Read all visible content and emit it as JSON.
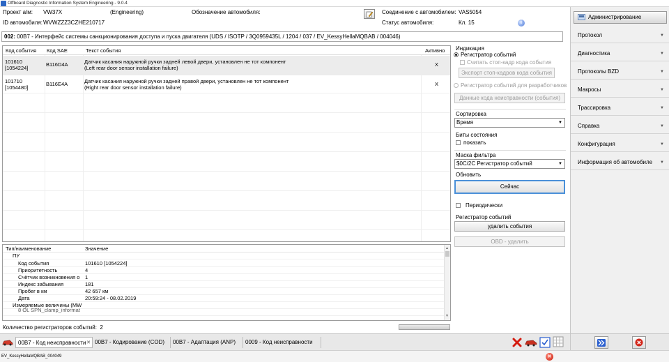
{
  "window": {
    "title": "Offboard Diagnostic Information System Engineering - 9.0.4"
  },
  "info": {
    "project_label": "Проект а/м:",
    "project_value": "VW37X",
    "mode": "(Engineering)",
    "vehicle_desig_label": "Обозначение автомобиля:",
    "vin_label": "ID автомобиля:",
    "vin_value": "WVWZZZ3CZHE210717",
    "connection_label": "Соединение с автомобилем:",
    "connection_value": "VAS5054",
    "vehicle_status_label": "Статус автомобиля:",
    "vehicle_status_value": "Кл. 15"
  },
  "ecu_path": {
    "number": "002:",
    "text": " 00B7 - Интерфейс системы санкционирования доступа и пуска двигателя  (UDS / ISOTP / 3Q0959435L / 1204 / 037 / EV_KessyHellaMQBAB / 004046)"
  },
  "events": {
    "headers": {
      "code": "Код события",
      "sae": "Код SAE",
      "text": "Текст события",
      "active": "Активно"
    },
    "rows": [
      {
        "code1": "101610",
        "code2": "[1054224]",
        "sae": "B116D4A",
        "text1": "Датчик касания наружной ручки задней левой двери, установлен не тот компонент",
        "text2": "(Left rear door sensor installation failure)",
        "active": "X"
      },
      {
        "code1": "101710",
        "code2": "[1054480]",
        "sae": "B116E4A",
        "text1": "Датчик касания наружной ручки задней правой двери, установлен не тот компонент",
        "text2": "(Right rear door sensor installation failure)",
        "active": "X"
      }
    ]
  },
  "details": {
    "headers": {
      "name": "Тип/наименование",
      "value": "Значение"
    },
    "group": "ПУ",
    "rows": [
      {
        "name": "Код события",
        "value": "101610 [1054224]"
      },
      {
        "name": "Приоритетность",
        "value": "4"
      },
      {
        "name": "Счётчик возникновения о",
        "value": "1"
      },
      {
        "name": "Индекс забывания",
        "value": "181"
      },
      {
        "name": "Пробег в км",
        "value": "42 657 км"
      },
      {
        "name": "Дата",
        "value": "20:59:24 - 08.02.2019"
      }
    ],
    "group2": "Измеряемые величины (MW",
    "cut_row": "8 OL SPN_clamp_informat"
  },
  "options": {
    "indication_label": "Индикация",
    "event_recorder": "Регистратор событий",
    "read_freeze_frame": "Считать стоп-кадр кода события",
    "export_freeze_frames": "Экспорт стоп-кадров кода события",
    "dev_event_recorder": "Регистратор событий для разработчиков",
    "fault_code_data": "Данные кода неисправности (события)",
    "sort_label": "Сортировка",
    "sort_value": "Время",
    "status_bits_label": "Биты состояния",
    "show_label": "показать",
    "filter_mask_label": "Маска фильтра",
    "filter_mask_value": "$0C/2C Регистратор событий",
    "refresh_label": "Обновить",
    "now_button": "Сейчас",
    "periodic_label": "Периодически",
    "event_recorder2": "Регистратор событий",
    "delete_events": "удалить события",
    "obd_delete": "OBD - удалить"
  },
  "count": {
    "label": "Количество регистраторов событий:",
    "value": "2"
  },
  "sidebar": {
    "admin": "Администрирование",
    "items": [
      {
        "label": "Протокол"
      },
      {
        "label": "Диагностика"
      },
      {
        "label": "Протоколы BZD"
      },
      {
        "label": "Макросы"
      },
      {
        "label": "Трассировка"
      },
      {
        "label": "Справка"
      },
      {
        "label": "Конфигурация"
      },
      {
        "label": "Информация об автомобиле"
      }
    ]
  },
  "bottom_tabs": [
    {
      "label": "00B7 - Код неисправности"
    },
    {
      "label": "00B7 - Кодирование (COD)"
    },
    {
      "label": "00B7 - Адаптация (ANP)"
    },
    {
      "label": "0009 - Код неисправности"
    }
  ],
  "statusbar": {
    "text": "EV_KessyHellaMQBAB_004049"
  },
  "colors": {
    "accent": "#4a90d9",
    "error": "#c81c0c",
    "blue_button": "#2a5fd0"
  }
}
